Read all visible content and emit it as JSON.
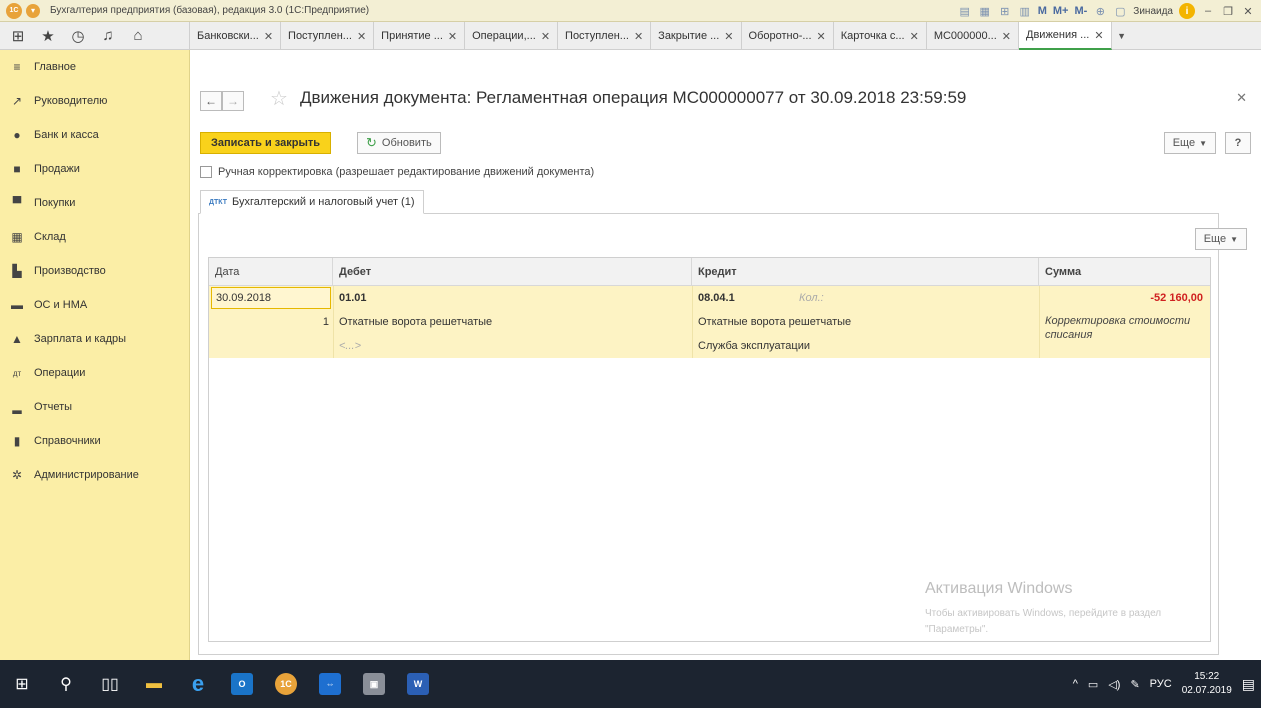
{
  "window": {
    "logo": "1С",
    "title": "Бухгалтерия предприятия (базовая), редакция 3.0  (1С:Предприятие)",
    "m_labels": [
      "M",
      "M+",
      "M-"
    ],
    "user": "Зинаида",
    "info": "i"
  },
  "tabs": [
    {
      "label": "Банковски..."
    },
    {
      "label": "Поступлен..."
    },
    {
      "label": "Принятие ..."
    },
    {
      "label": "Операции,..."
    },
    {
      "label": "Поступлен..."
    },
    {
      "label": "Закрытие ..."
    },
    {
      "label": "Оборотно-..."
    },
    {
      "label": "Карточка с..."
    },
    {
      "label": "МС000000..."
    },
    {
      "label": "Движения ..."
    }
  ],
  "sidebar": {
    "items": [
      {
        "label": "Главное",
        "icon": "menu-lines-icon"
      },
      {
        "label": "Руководителю",
        "icon": "trend-icon"
      },
      {
        "label": "Банк и касса",
        "icon": "coin-icon"
      },
      {
        "label": "Продажи",
        "icon": "bag-icon"
      },
      {
        "label": "Покупки",
        "icon": "cart-icon"
      },
      {
        "label": "Склад",
        "icon": "warehouse-icon"
      },
      {
        "label": "Производство",
        "icon": "factory-icon"
      },
      {
        "label": "ОС и НМА",
        "icon": "truck-icon"
      },
      {
        "label": "Зарплата и кадры",
        "icon": "person-icon"
      },
      {
        "label": "Операции",
        "icon": "dt-kt-icon"
      },
      {
        "label": "Отчеты",
        "icon": "bar-chart-icon"
      },
      {
        "label": "Справочники",
        "icon": "book-icon"
      },
      {
        "label": "Администрирование",
        "icon": "gear-icon"
      }
    ]
  },
  "document": {
    "title": "Движения документа: Регламентная операция МС000000077 от 30.09.2018 23:59:59",
    "save_close": "Записать и закрыть",
    "refresh": "Обновить",
    "more": "Еще",
    "help": "?",
    "manual_edit": "Ручная корректировка (разрешает редактирование движений документа)",
    "subtab": "Бухгалтерский и налоговый учет (1)",
    "subtab_icon": "ДТКТ",
    "table_more": "Еще"
  },
  "table": {
    "headers": {
      "date": "Дата",
      "debit": "Дебет",
      "credit": "Кредит",
      "sum": "Сумма"
    },
    "row": {
      "date": "30.09.2018",
      "debit_account": "01.01",
      "row_num": "1",
      "debit_sub1": "Откатные ворота решетчатые",
      "debit_sub2": "<...>",
      "credit_account": "08.04.1",
      "credit_qty": "Кол.:",
      "credit_sub1": "Откатные ворота решетчатые",
      "credit_sub2": "Служба эксплуатации",
      "sum": "-52 160,00",
      "content": "Корректировка стоимости списания"
    }
  },
  "watermark": {
    "title": "Активация Windows",
    "text": "Чтобы активировать Windows, перейдите в раздел \"Параметры\"."
  },
  "taskbar": {
    "lang": "РУС",
    "time": "15:22",
    "date": "02.07.2019",
    "outlook": "O",
    "onec": "1C",
    "word": "W"
  }
}
